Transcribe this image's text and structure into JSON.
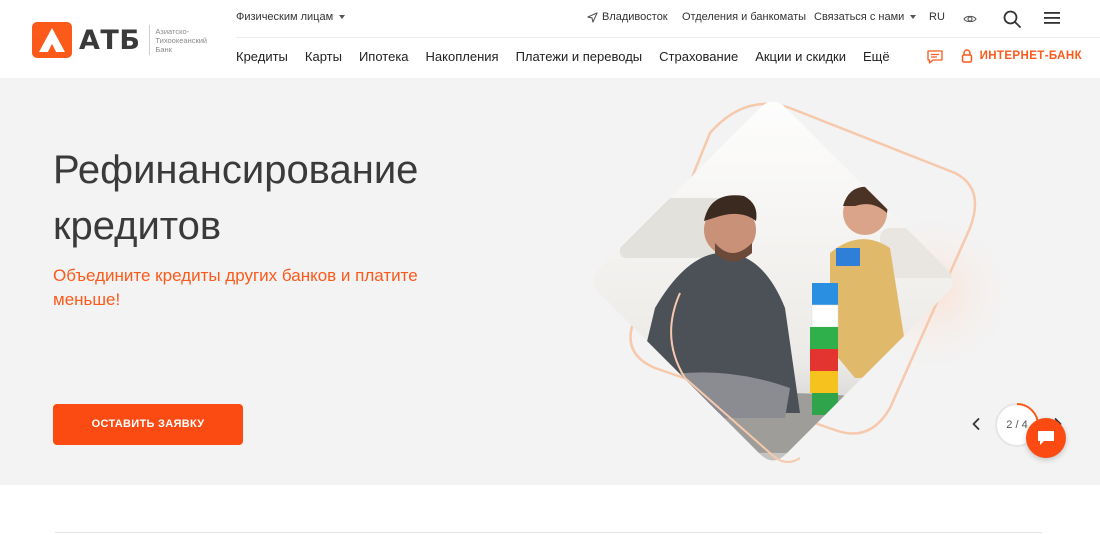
{
  "brand": {
    "name": "АТБ",
    "subtitle": "Азиатско-Тихоокеанский Банк",
    "accent_color": "#fb5a1b"
  },
  "topbar": {
    "segment": "Физическим лицам",
    "city": "Владивосток",
    "branches": "Отделения и банкоматы",
    "contact": "Связаться с нами",
    "lang": "RU",
    "icons": [
      "location-arrow-icon",
      "eye-icon",
      "search-icon",
      "menu-icon"
    ]
  },
  "nav": {
    "items": [
      "Кредиты",
      "Карты",
      "Ипотека",
      "Накопления",
      "Платежи и переводы",
      "Страхование",
      "Акции и скидки",
      "Ещё"
    ],
    "internet_bank": "ИНТЕРНЕТ-БАНК"
  },
  "hero": {
    "title": "Рефинансирование кредитов",
    "subtitle": "Объедините кредиты других банков и платите меньше!",
    "cta": "ОСТАВИТЬ ЗАЯВКУ",
    "pager": "2 / 4",
    "slide_index": 2,
    "slide_total": 4,
    "pager_progress": 0.3
  }
}
